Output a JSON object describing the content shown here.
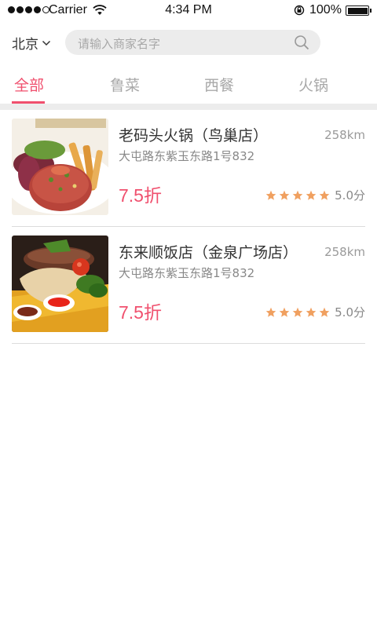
{
  "status_bar": {
    "carrier": "Carrier",
    "time": "4:34 PM",
    "battery": "100%",
    "signal_icon": "signal-dots-icon",
    "wifi_icon": "wifi-icon",
    "lock_icon": "rotation-lock-icon",
    "battery_icon": "battery-icon"
  },
  "header": {
    "city": "北京",
    "city_chevron_icon": "chevron-down-icon",
    "search_placeholder": "请输入商家名字",
    "search_icon": "search-icon"
  },
  "tabs": [
    {
      "label": "全部",
      "active": true
    },
    {
      "label": "鲁菜",
      "active": false
    },
    {
      "label": "西餐",
      "active": false
    },
    {
      "label": "火锅",
      "active": false
    }
  ],
  "restaurants": [
    {
      "name": "老码头火锅（鸟巢店）",
      "distance": "258km",
      "address": "大屯路东紫玉东路1号832",
      "discount": "7.5折",
      "rating": "5.0分",
      "stars": 5,
      "image": "steak-tartare-plate"
    },
    {
      "name": "东来顺饭店（金泉广场店）",
      "distance": "258km",
      "address": "大屯路东紫玉东路1号832",
      "discount": "7.5折",
      "rating": "5.0分",
      "stars": 5,
      "image": "grilled-meat-plate"
    }
  ],
  "colors": {
    "accent": "#f0506e",
    "star": "#f0a060",
    "divider": "#ececec"
  }
}
